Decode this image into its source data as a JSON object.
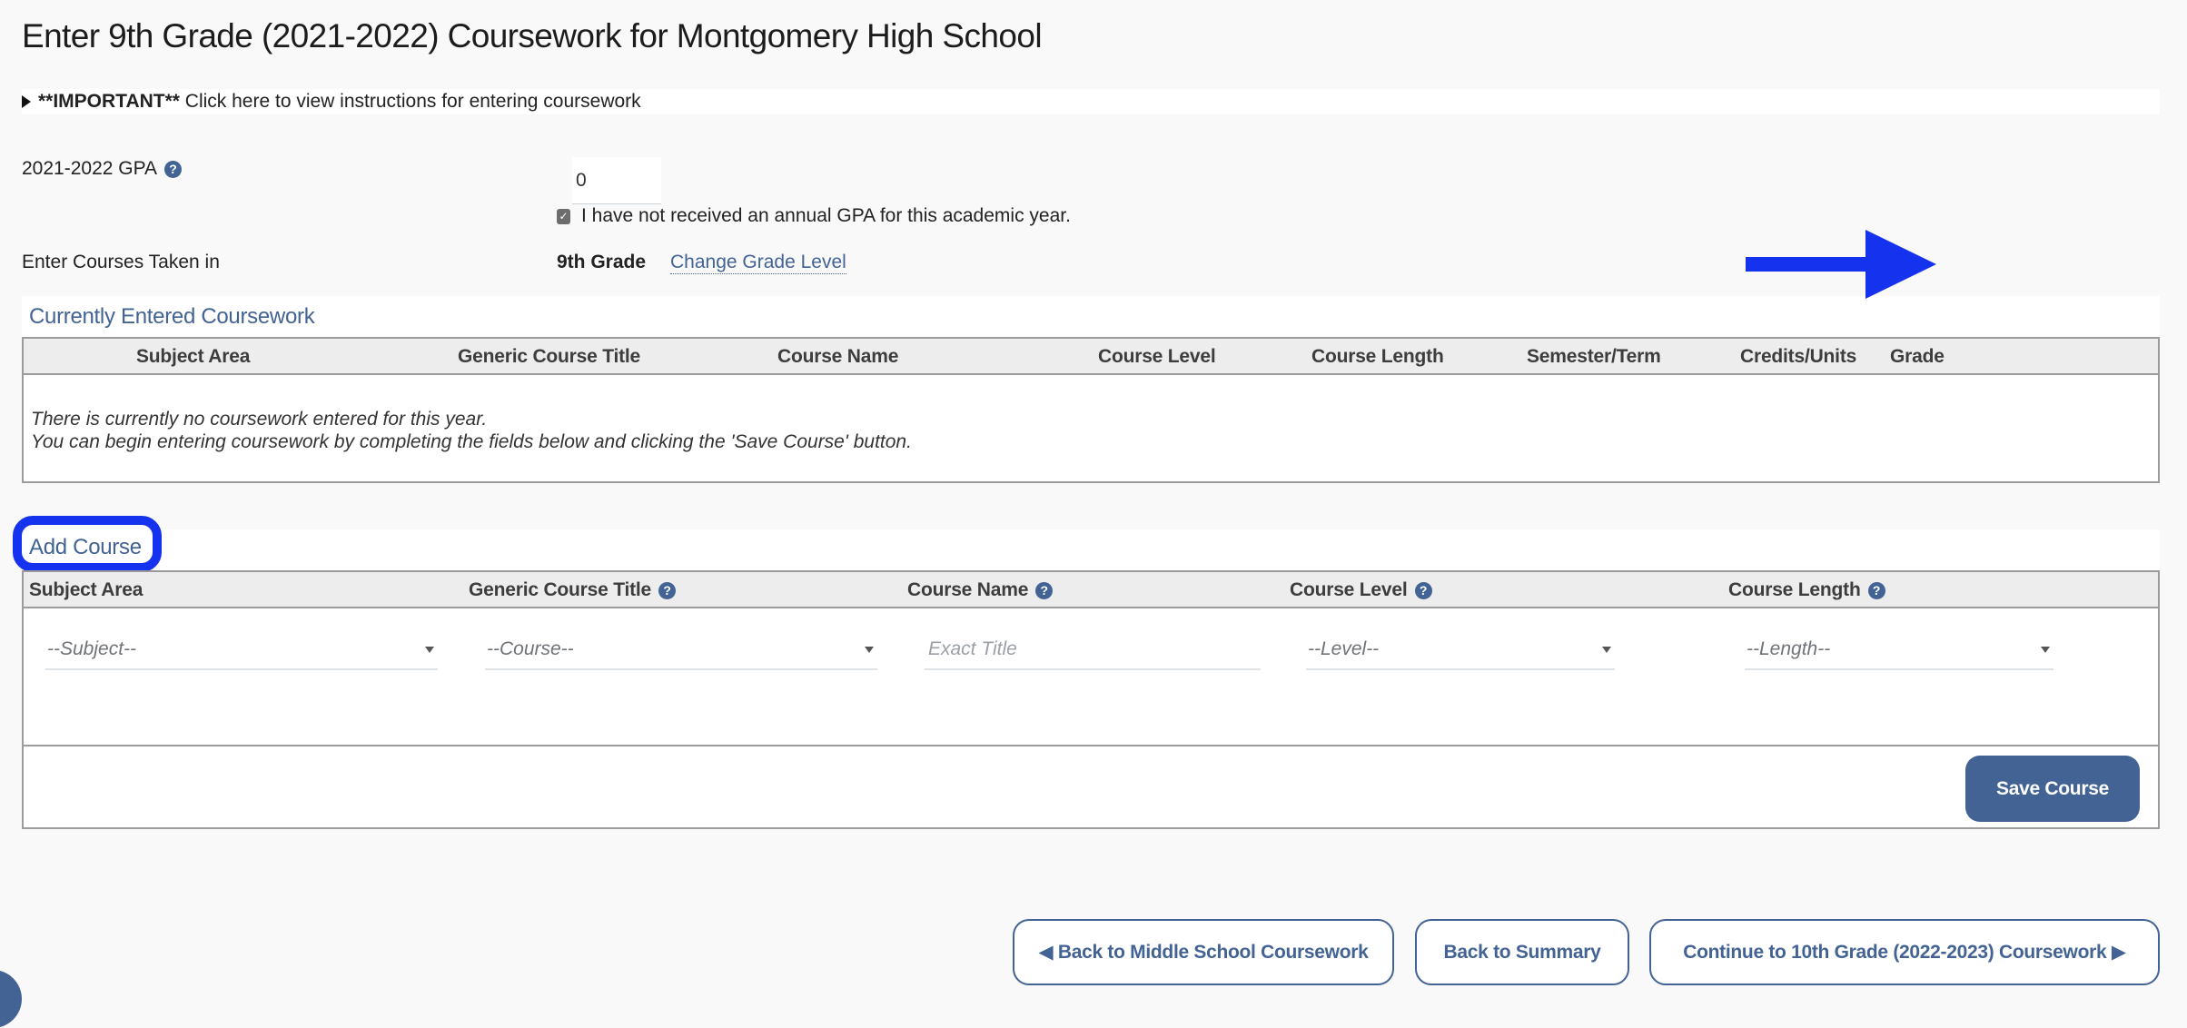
{
  "page": {
    "title": "Enter 9th Grade (2021-2022) Coursework for Montgomery High School"
  },
  "instructions": {
    "bold": "**IMPORTANT**",
    "text": " Click here to view instructions for entering coursework"
  },
  "gpa": {
    "label": "2021-2022 GPA",
    "help_icon": "?",
    "value": "0",
    "checkbox_checked": true,
    "checkbox_label": "I have not received an annual GPA for this academic year."
  },
  "grade_level": {
    "label": "Enter Courses Taken in",
    "value": "9th Grade",
    "change_link": "Change Grade Level"
  },
  "current_coursework": {
    "title": "Currently Entered Coursework",
    "columns": [
      "Subject Area",
      "Generic Course Title",
      "Course Name",
      "Course Level",
      "Course Length",
      "Semester/Term",
      "Credits/Units",
      "Grade"
    ],
    "empty_line1": "There is currently no coursework entered for this year.",
    "empty_line2": "You can begin entering coursework by completing the fields below and clicking the 'Save Course' button."
  },
  "add_course": {
    "title": "Add Course",
    "columns": [
      "Subject Area",
      "Generic Course Title",
      "Course Name",
      "Course Level",
      "Course Length"
    ],
    "subject_placeholder": "--Subject--",
    "course_placeholder": "--Course--",
    "name_placeholder": "Exact Title",
    "level_placeholder": "--Level--",
    "length_placeholder": "--Length--",
    "save_label": "Save Course"
  },
  "navigation": {
    "back_label": "◀ Back to Middle School Coursework",
    "summary_label": "Back to Summary",
    "next_label": "Continue to 10th Grade (2022-2023) Coursework ▶"
  },
  "colors": {
    "brand": "#426394",
    "annotation": "#1533ee",
    "header_bg": "#ededed"
  }
}
